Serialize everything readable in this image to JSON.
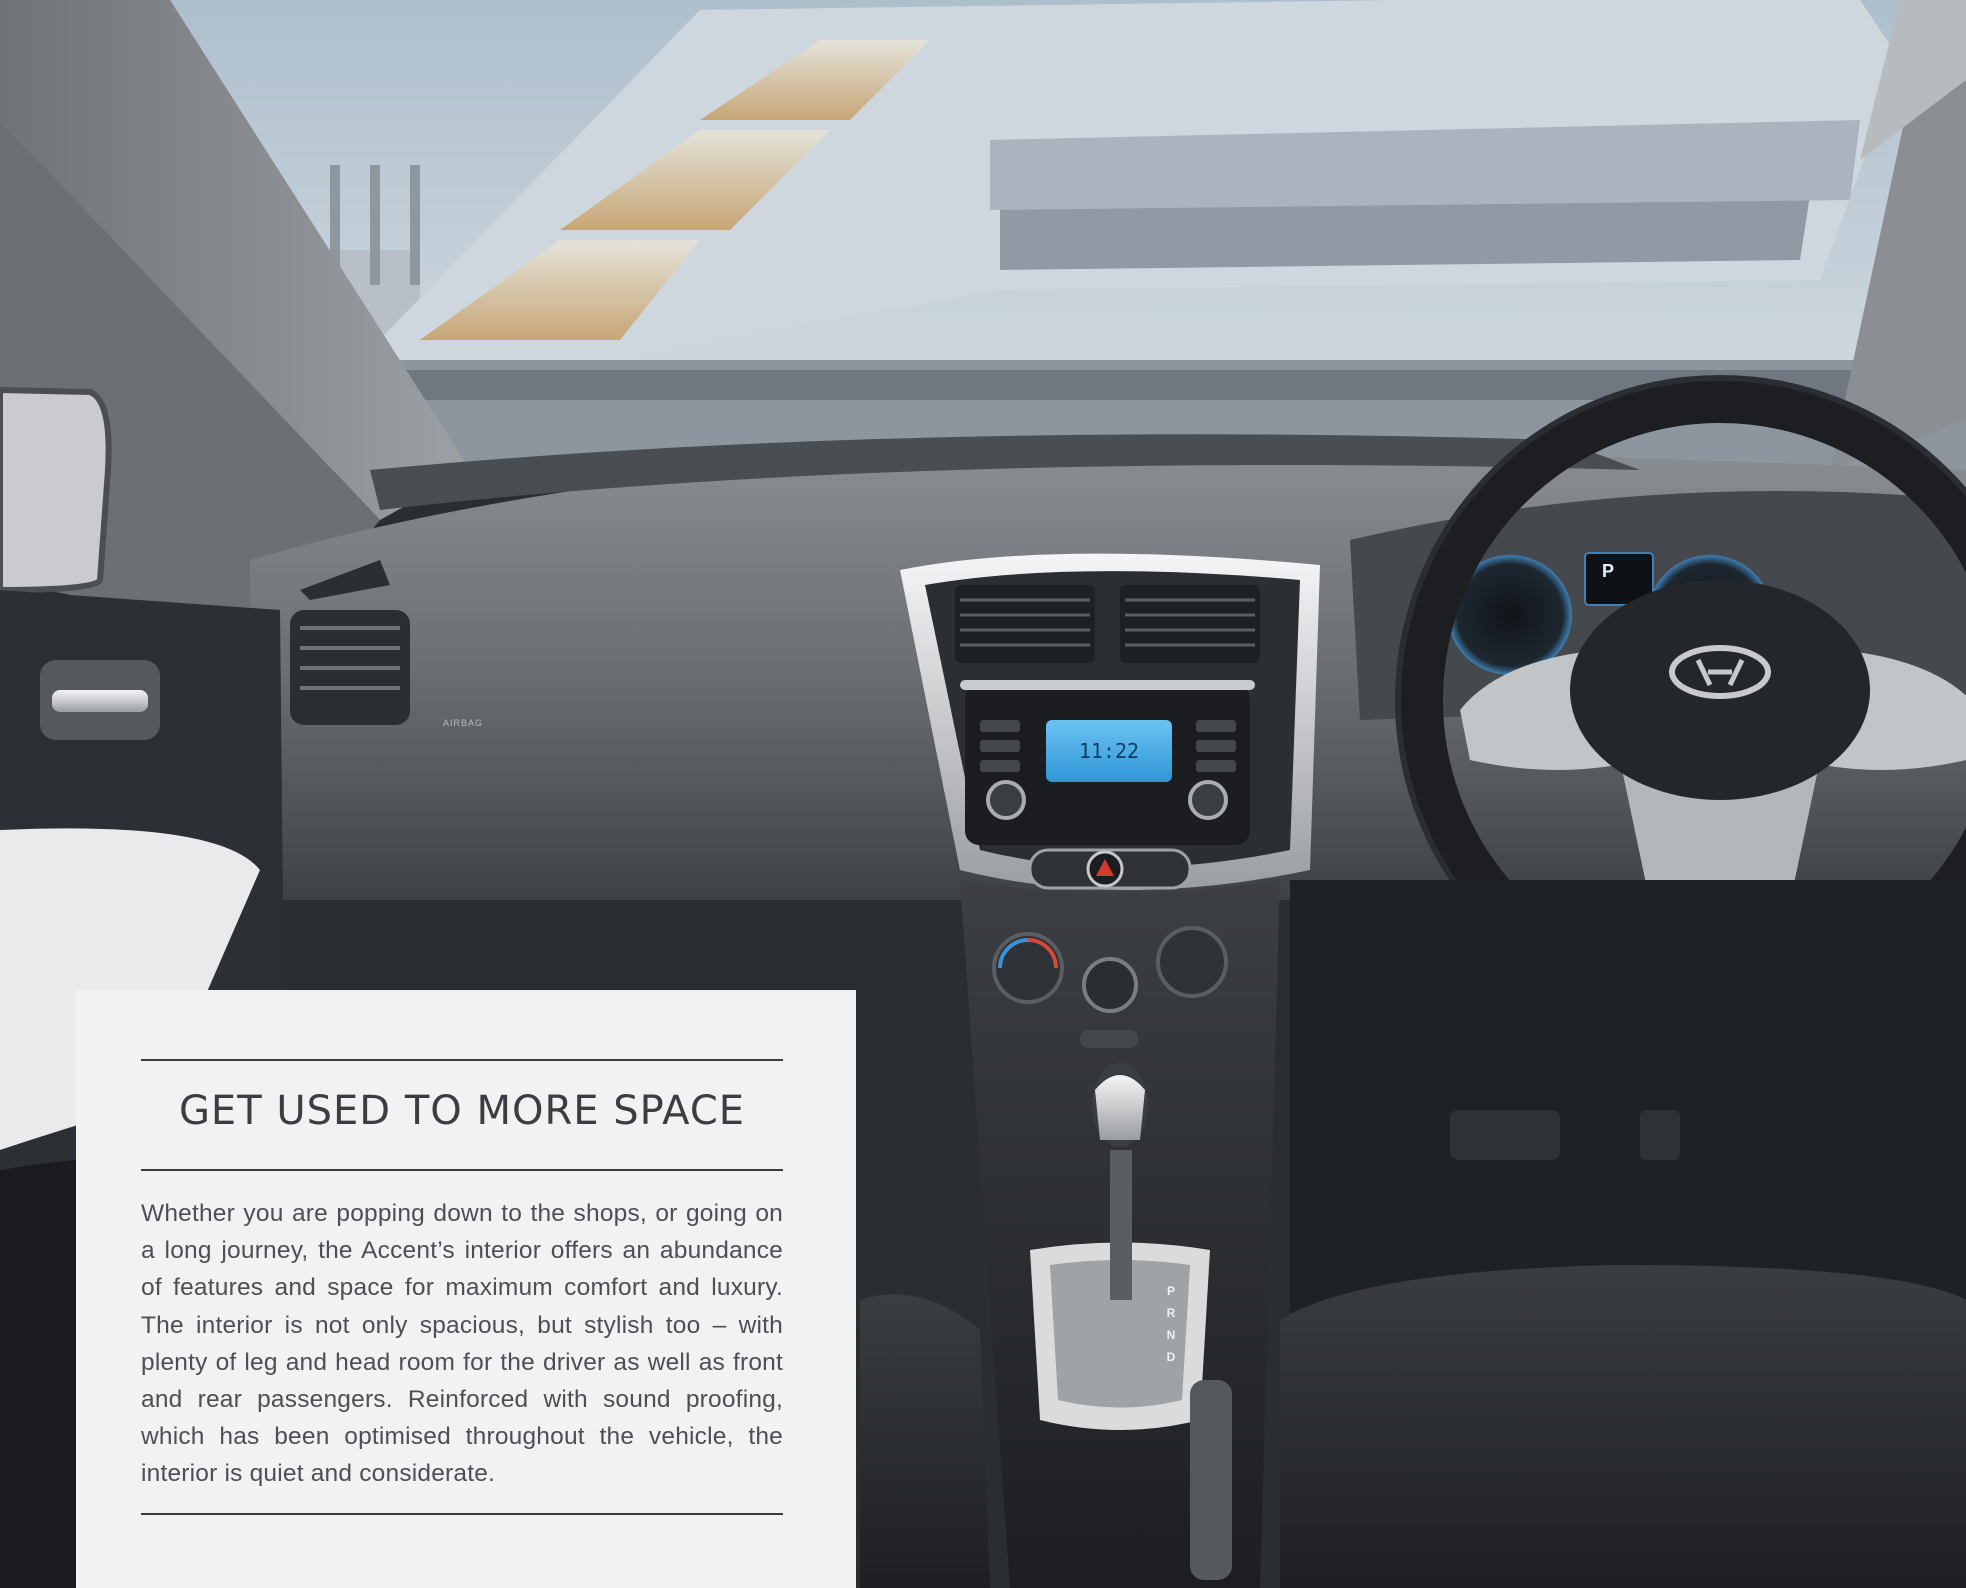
{
  "panel": {
    "title": "GET USED TO MORE SPACE",
    "body": "Whether you are popping down to the shops, or going on a long journey, the Accent’s interior offers an abundance of features and space for maximum comfort and luxury. The interior is not only spacious, but stylish too – with plenty of leg and head room for the driver as well as front and rear passengers. Reinforced with sound proofing, which has been optimised throughout the vehicle, the interior is quiet and considerate."
  },
  "dashboard": {
    "radio_time": "11:22",
    "airbag_label": "AIRBAG",
    "cluster_gear": "P",
    "gear_positions": [
      "P",
      "R",
      "N",
      "D"
    ]
  },
  "colors": {
    "panel_background": "#f1f2f2",
    "title_text": "#3c3d40",
    "body_text": "#4d4f52",
    "radio_display": "#3fa9e8",
    "dash": "#5f6266"
  }
}
